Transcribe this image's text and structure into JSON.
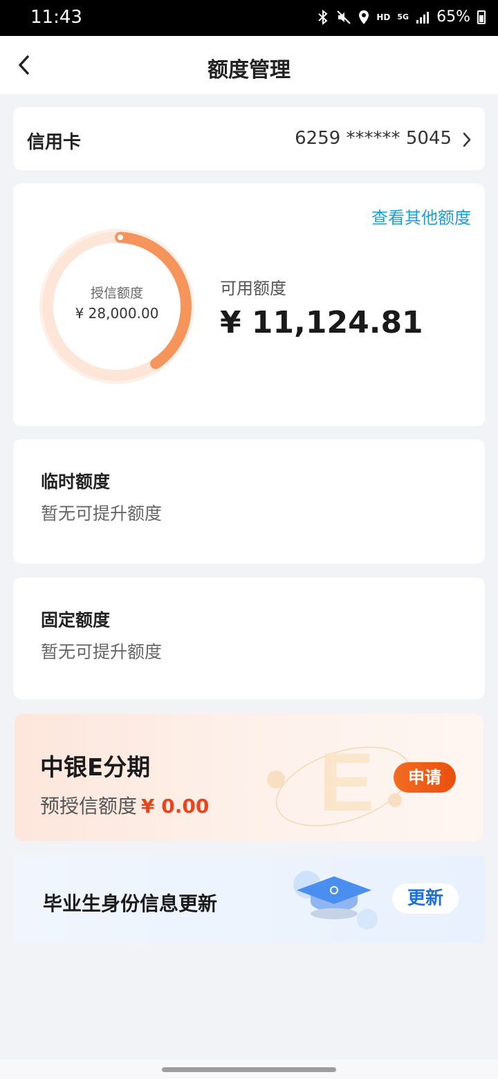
{
  "status_bar": {
    "time": "11:43",
    "network_hd": "HD",
    "network_5g": "5G",
    "battery": "65%"
  },
  "header": {
    "title": "额度管理"
  },
  "credit_card": {
    "label": "信用卡",
    "number": "6259 ****** 5045"
  },
  "limit": {
    "view_other": "查看其他额度",
    "granted_label": "授信额度",
    "granted_value": "¥ 28,000.00",
    "available_label": "可用额度",
    "available_value": "¥ 11,124.81",
    "available_fraction": 0.397
  },
  "temporary": {
    "title": "临时额度",
    "subtitle": "暂无可提升额度"
  },
  "fixed": {
    "title": "固定额度",
    "subtitle": "暂无可提升额度"
  },
  "installment": {
    "title": "中银E分期",
    "pre_label": "预授信额度",
    "pre_value": "¥ 0.00",
    "button": "申请"
  },
  "graduate": {
    "title": "毕业生身份信息更新",
    "button": "更新"
  },
  "colors": {
    "accent_blue": "#1b9fd6",
    "ring_orange": "#f6955b",
    "apply_orange": "#ec4f0c",
    "update_blue": "#1e6fd9"
  }
}
